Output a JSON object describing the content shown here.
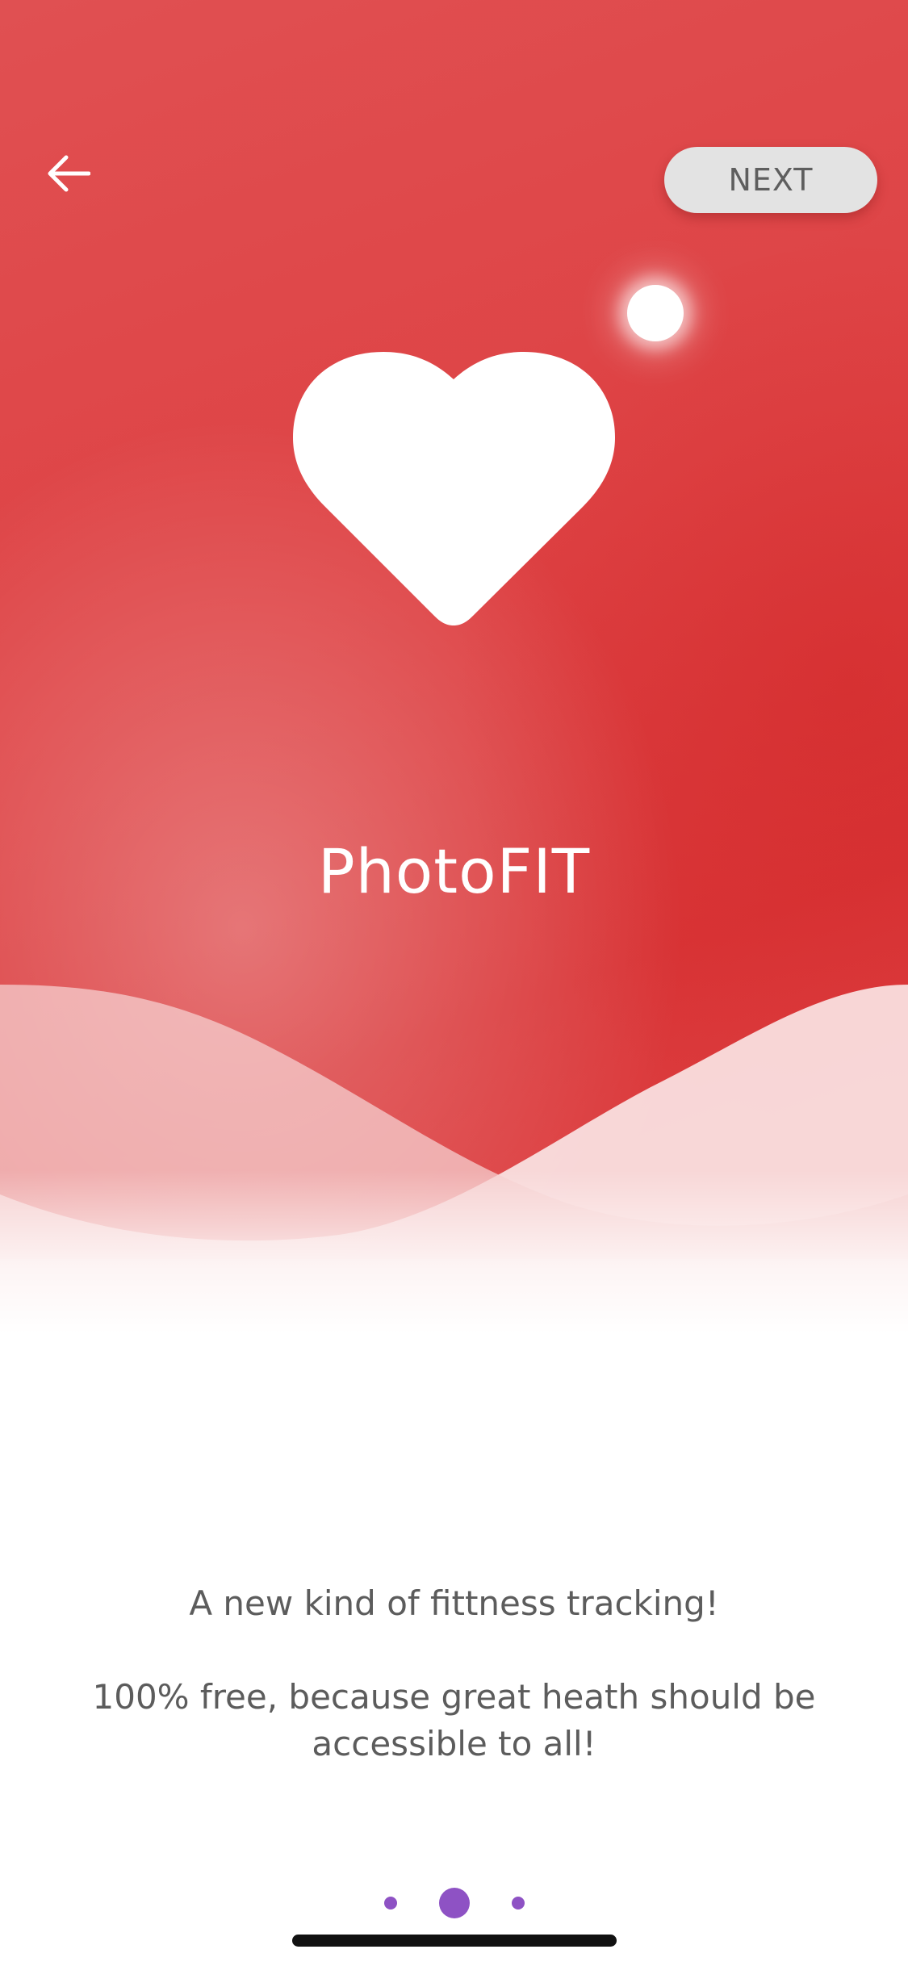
{
  "header": {
    "back_icon": "arrow-left-icon",
    "next_label": "NEXT"
  },
  "hero": {
    "icon": "heart-icon",
    "title": "PhotoFIT",
    "accent_color": "#dd3b3d"
  },
  "content": {
    "tagline": "A new kind of fittness tracking!",
    "description": "100% free, because great heath should be accessible to all!"
  },
  "pager": {
    "count": 3,
    "active_index": 1,
    "dot_color": "#8e52c4"
  }
}
